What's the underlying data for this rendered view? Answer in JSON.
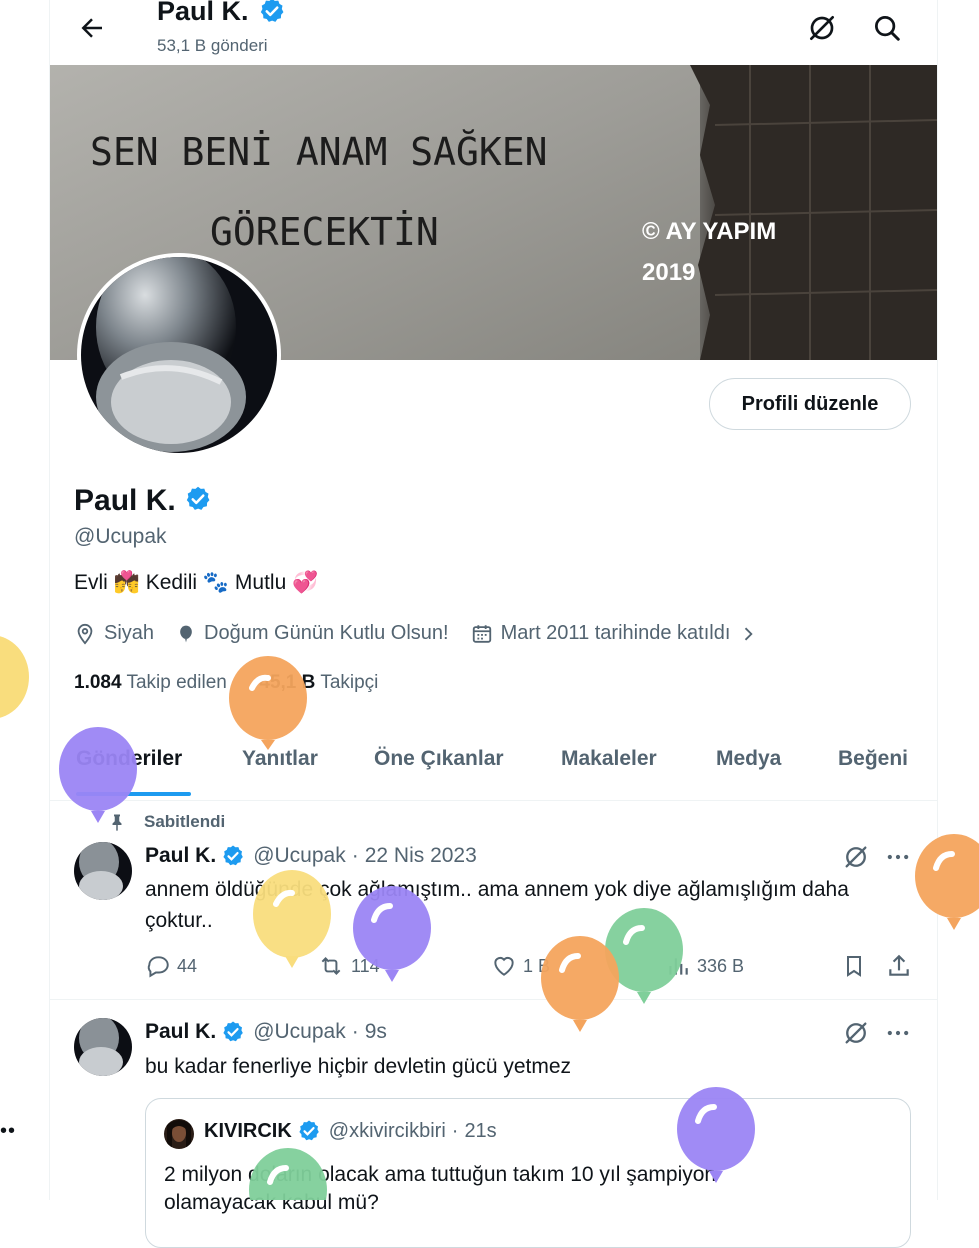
{
  "colors": {
    "accent": "#1d9bf0",
    "text": "#0f1419",
    "muted": "#536471",
    "border": "#cfd9de"
  },
  "topbar": {
    "title": "Paul K.",
    "post_count": "53,1 B gönderi",
    "back_icon": "arrow-left-icon",
    "grok_icon": "grok-icon",
    "search_icon": "search-icon"
  },
  "banner": {
    "line1": "SEN BENİ ANAM SAĞKEN",
    "line2": "GÖRECEKTİN",
    "copyright": "© AY YAPIM",
    "year": "2019"
  },
  "profile": {
    "edit_label": "Profili düzenle",
    "name": "Paul K.",
    "handle": "@Ucupak",
    "bio": {
      "w1": "Evli",
      "e1": "💏",
      "w2": "Kedili",
      "e2": "🐾",
      "w3": "Mutlu",
      "e3": "💞"
    },
    "location": "Siyah",
    "birthday": "Doğum Günün Kutlu Olsun!",
    "joined": "Mart 2011 tarihinde katıldı",
    "following_count": "1.084",
    "following_label": "Takip edilen",
    "followers_count": "45,1 B",
    "followers_label": "Takipçi"
  },
  "tabs": [
    "Gönderiler",
    "Yanıtlar",
    "Öne Çıkanlar",
    "Makaleler",
    "Medya",
    "Beğeni"
  ],
  "pinned_label": "Sabitlendi",
  "tweets": [
    {
      "name": "Paul K.",
      "handle": "@Ucupak",
      "sep": "·",
      "time": "22 Nis 2023",
      "text": "annem öldüğünde çok ağlamıştım.. ama annem yok diye ağlamışlığım daha çoktur..",
      "replies": "44",
      "retweets": "114",
      "likes": "1 B",
      "views": "336 B"
    },
    {
      "name": "Paul K.",
      "handle": "@Ucupak",
      "sep": "·",
      "time": "9s",
      "text": "bu kadar fenerliye hiçbir devletin gücü yetmez",
      "quote": {
        "name": "KIVIRCIK",
        "handle": "@xkivircikbiri",
        "sep": "·",
        "time": "21s",
        "text": "2 milyon doların olacak ama tuttuğun takım 10 yıl şampiyon",
        "text2": "olamayacak kabul mü?"
      }
    }
  ],
  "overlay": {
    "side_dots": "••"
  }
}
